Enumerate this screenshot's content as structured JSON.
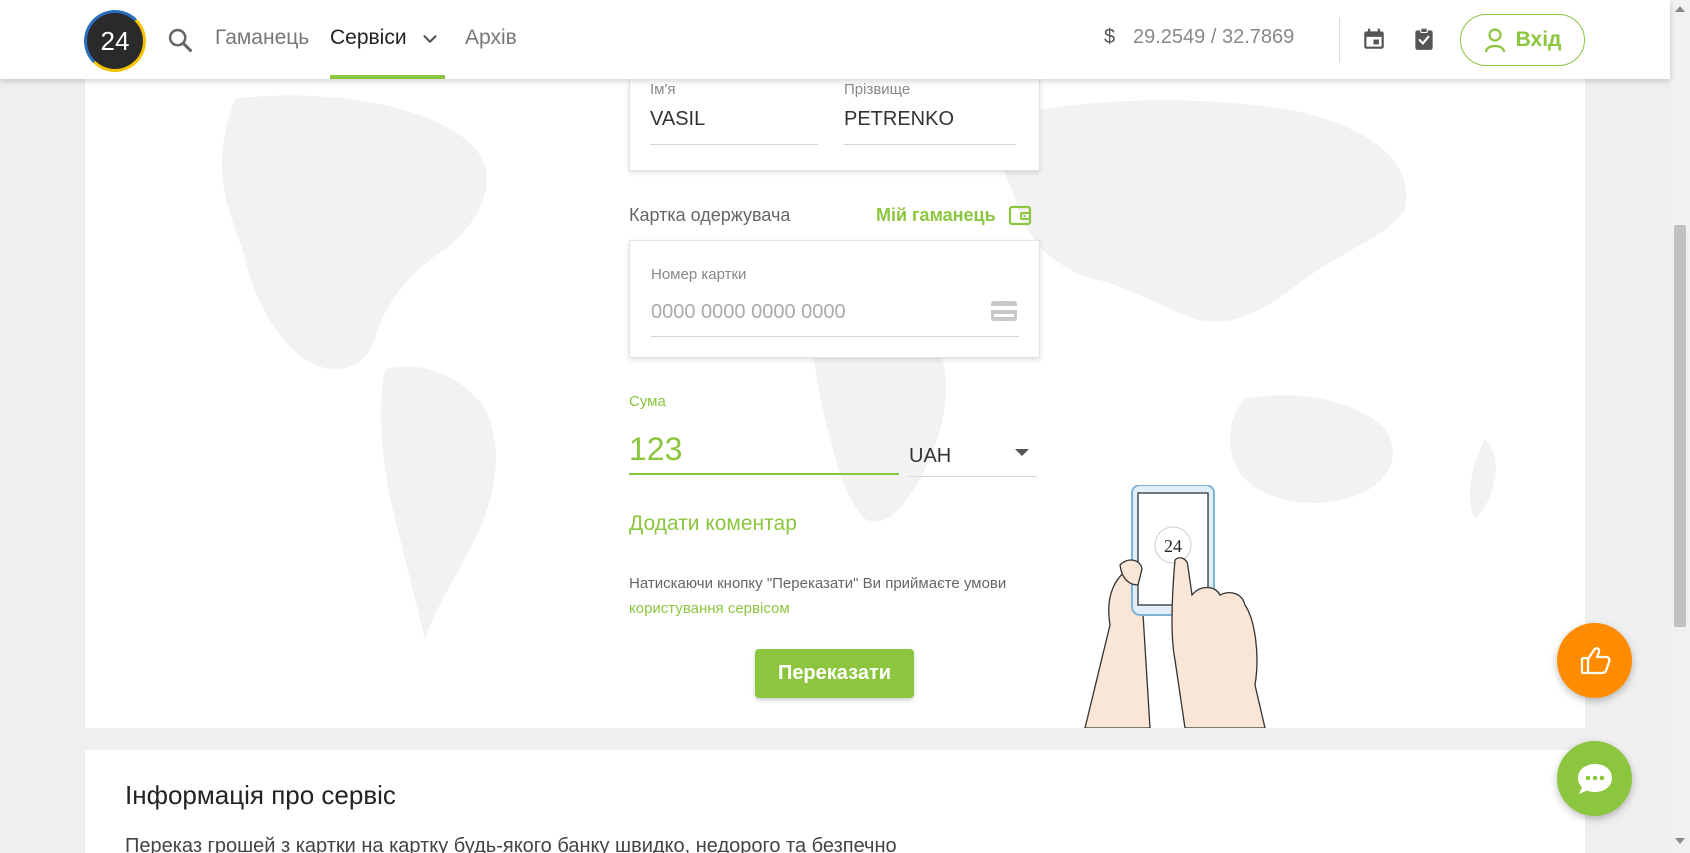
{
  "header": {
    "logo_text": "24",
    "nav": [
      {
        "label": "Гаманець",
        "active": false
      },
      {
        "label": "Сервіси",
        "active": true
      },
      {
        "label": "Архів",
        "active": false
      }
    ],
    "rate_currency": "$",
    "rate_value": "29.2549 / 32.7869",
    "login_label": "Вхід"
  },
  "form": {
    "first_name_label": "Ім'я",
    "first_name_value": "VASIL",
    "last_name_label": "Прізвище",
    "last_name_value": "PETRENKO",
    "recipient_card_title": "Картка одержувача",
    "my_wallet_label": "Мій гаманець",
    "card_number_label": "Номер картки",
    "card_number_placeholder": "0000 0000 0000 0000",
    "amount_label": "Сума",
    "amount_value": "123",
    "currency": "UAH",
    "add_comment": "Додати коментар",
    "terms_text": "Натискаючи кнопку \"Переказати\" Ви приймаєте умови",
    "terms_link": "користування сервісом",
    "submit_label": "Переказати"
  },
  "illustration": {
    "phone_badge": "24"
  },
  "info": {
    "title": "Інформація про сервіс",
    "text": "Переказ грошей з картки на картку будь-якого банку швидко, недорого та безпечно"
  },
  "colors": {
    "accent": "#8cc63f",
    "like_button": "#ff8c00"
  },
  "icons": [
    "search-icon",
    "chevron-down-icon",
    "calendar-icon",
    "clipboard-check-icon",
    "user-icon",
    "wallet-icon",
    "credit-card-icon",
    "thumbs-up-icon",
    "chat-icon"
  ]
}
